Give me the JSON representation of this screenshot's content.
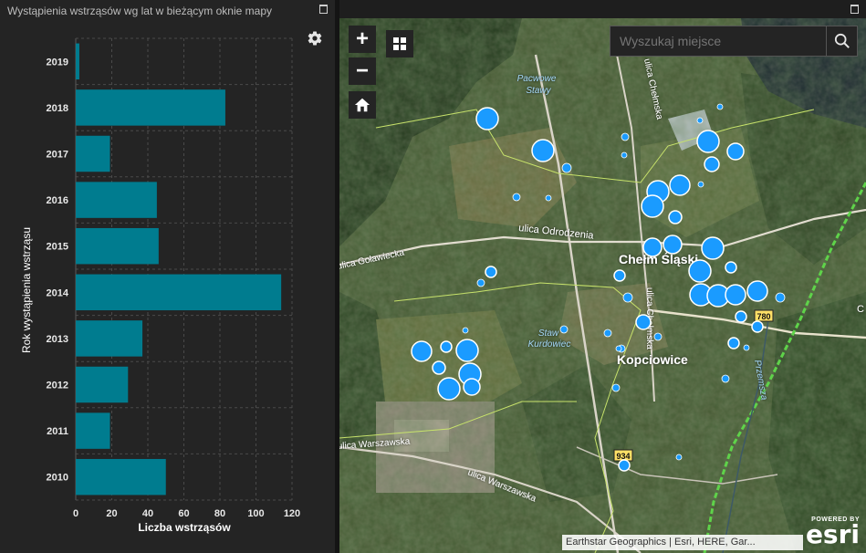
{
  "panel": {
    "title": "Wystąpienia wstrząsów wg lat w bieżącym oknie mapy"
  },
  "chart_data": {
    "type": "bar",
    "orientation": "horizontal",
    "categories": [
      "2019",
      "2018",
      "2017",
      "2016",
      "2015",
      "2014",
      "2013",
      "2012",
      "2011",
      "2010"
    ],
    "values": [
      2,
      83,
      19,
      45,
      46,
      114,
      37,
      29,
      19,
      50
    ],
    "xlabel": "Liczba wstrząsów",
    "ylabel": "Rok wystąpienia wstrząsu",
    "xlim": [
      0,
      120
    ],
    "xticks": [
      0,
      20,
      40,
      60,
      80,
      100,
      120
    ],
    "grid": true,
    "bar_color": "#007c8f"
  },
  "map": {
    "search_placeholder": "Wyszukaj miejsce",
    "zoom_in_label": "+",
    "zoom_out_label": "−",
    "attribution": "Earthstar Geographics | Esri, HERE, Gar...",
    "logo_powered": "POWERED BY",
    "logo_word": "esri",
    "labels": {
      "pond1_line1": "Pacwowe",
      "pond1_line2": "Stawy",
      "pond2_line1": "Staw",
      "pond2_line2": "Kurdowiec",
      "street_chelmska_top": "ulica Chełmska",
      "street_chelmska_mid": "ulica Chełmska",
      "street_odrodzenia": "ulica Odrodzenia",
      "street_golawiecka": "ulica Goławiecka",
      "street_warszawska_left": "ulica Warszawska",
      "street_warszawska_mid": "ulica Warszawska",
      "river_przemsza": "Przemsza",
      "town_chelm": "Chełm Śląski",
      "town_kopciowice": "Kopciowice",
      "road_780": "780",
      "road_934": "934",
      "edge_c": "C"
    },
    "colors": {
      "marker": "#1a9bff",
      "marker_stroke": "#ffffff",
      "boundary": "#c8e36b",
      "bikeway": "#5fd34a"
    }
  }
}
